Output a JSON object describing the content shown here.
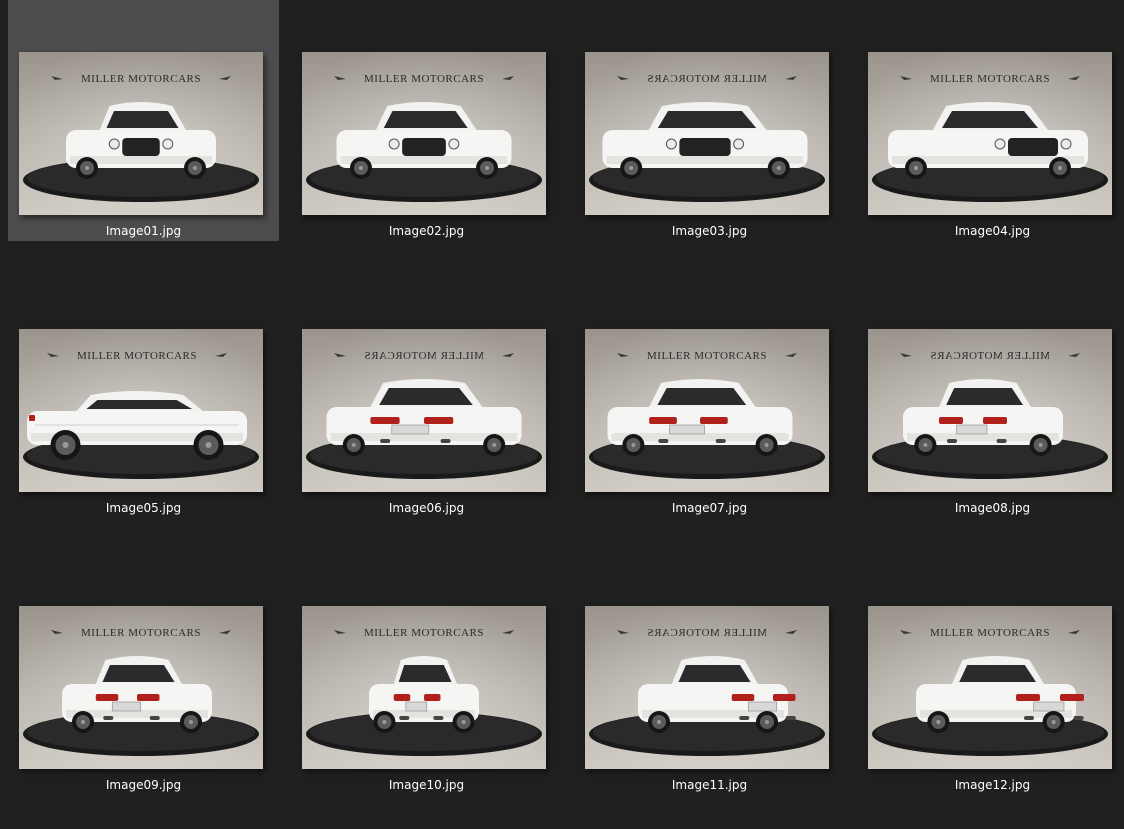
{
  "brand_text": "MILLER MOTORCARS",
  "colors": {
    "background": "#202020",
    "selected_tile": "#4d4d4f",
    "caption_text": "#ffffff"
  },
  "files": [
    {
      "name": "Image01.jpg",
      "selected": true,
      "view": "front"
    },
    {
      "name": "Image02.jpg",
      "selected": false,
      "view": "front-left"
    },
    {
      "name": "Image03.jpg",
      "selected": false,
      "view": "front-left-3q"
    },
    {
      "name": "Image04.jpg",
      "selected": false,
      "view": "front-right"
    },
    {
      "name": "Image05.jpg",
      "selected": false,
      "view": "side-left"
    },
    {
      "name": "Image06.jpg",
      "selected": false,
      "view": "rear-left-3q"
    },
    {
      "name": "Image07.jpg",
      "selected": false,
      "view": "rear-left"
    },
    {
      "name": "Image08.jpg",
      "selected": false,
      "view": "rear-left-slight"
    },
    {
      "name": "Image09.jpg",
      "selected": false,
      "view": "rear-left-near"
    },
    {
      "name": "Image10.jpg",
      "selected": false,
      "view": "rear"
    },
    {
      "name": "Image11.jpg",
      "selected": false,
      "view": "rear-right"
    },
    {
      "name": "Image12.jpg",
      "selected": false,
      "view": "rear-right-3q"
    }
  ]
}
